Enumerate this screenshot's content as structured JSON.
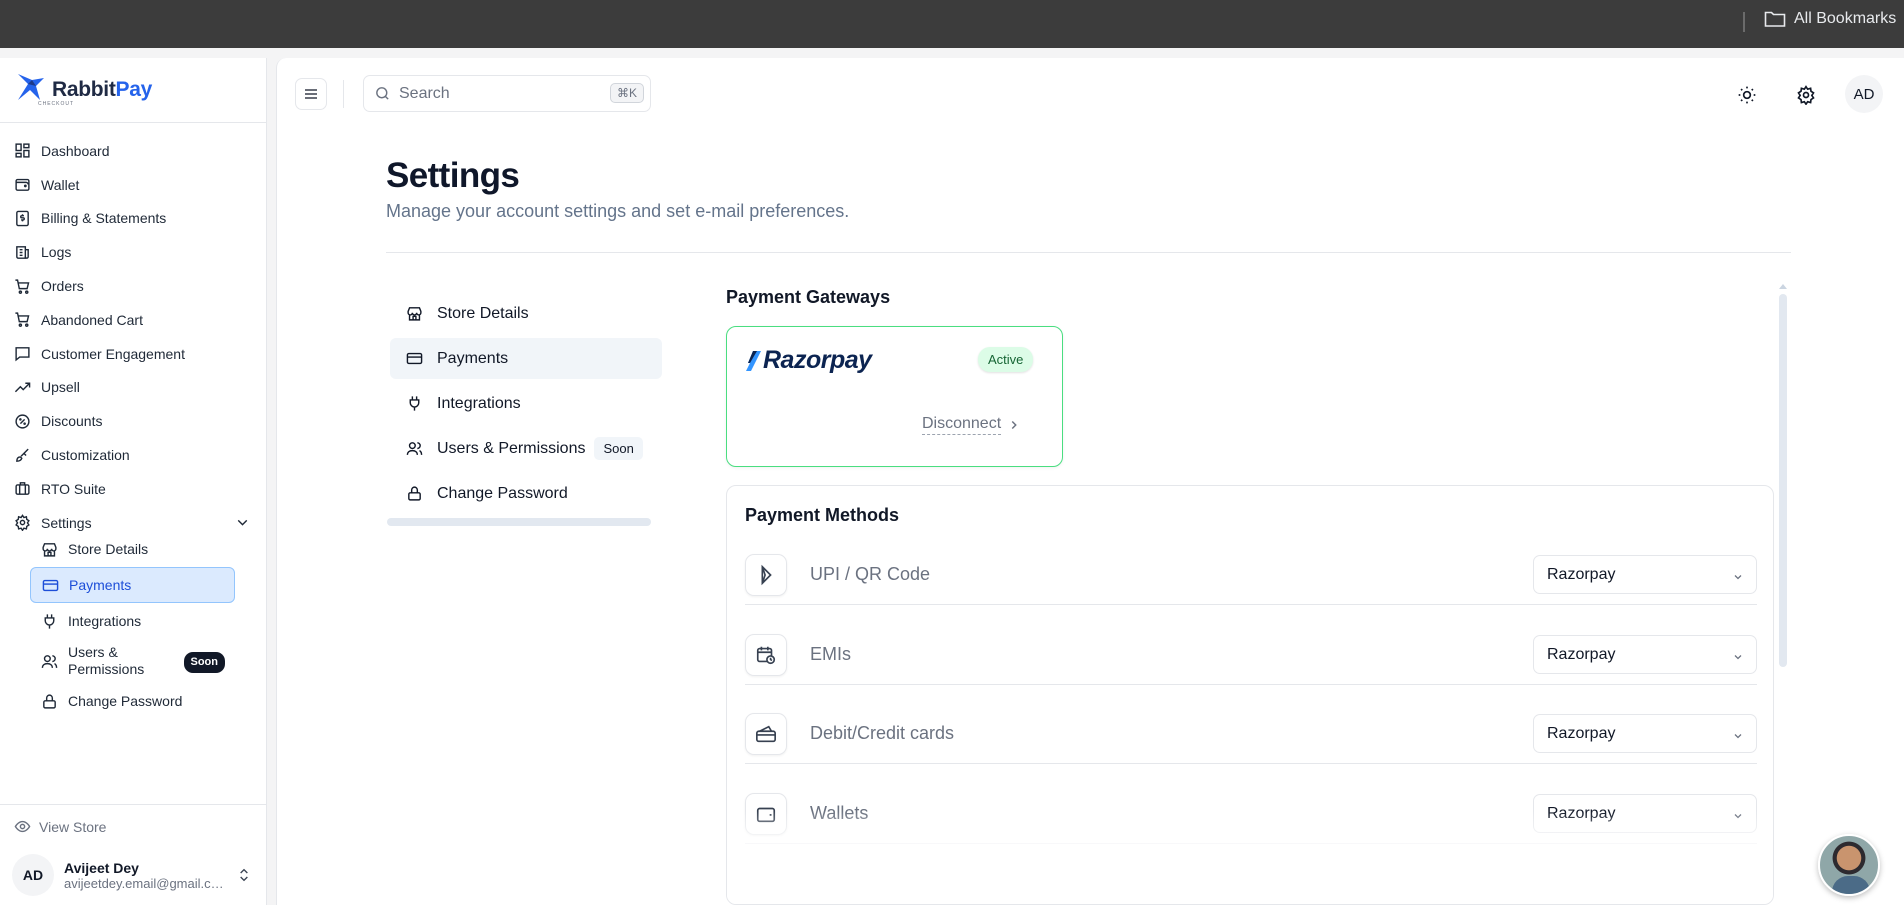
{
  "browser": {
    "bookmarks_label": "All Bookmarks"
  },
  "brand": {
    "name_part1": "Rabbit",
    "name_part2": "Pay",
    "tagline": "CHECKOUT",
    "color": "#2563eb"
  },
  "sidebar": {
    "items": [
      {
        "label": "Dashboard",
        "icon": "dashboard-icon"
      },
      {
        "label": "Wallet",
        "icon": "wallet-icon"
      },
      {
        "label": "Billing & Statements",
        "icon": "billing-icon"
      },
      {
        "label": "Logs",
        "icon": "logs-icon"
      },
      {
        "label": "Orders",
        "icon": "cart-icon"
      },
      {
        "label": "Abandoned Cart",
        "icon": "cart-icon"
      },
      {
        "label": "Customer Engagement",
        "icon": "message-icon"
      },
      {
        "label": "Upsell",
        "icon": "trending-up-icon"
      },
      {
        "label": "Discounts",
        "icon": "discount-icon"
      },
      {
        "label": "Customization",
        "icon": "paintbrush-icon"
      },
      {
        "label": "RTO Suite",
        "icon": "luggage-icon"
      },
      {
        "label": "Settings",
        "icon": "gear-icon"
      }
    ],
    "sub_items": [
      {
        "label": "Store Details",
        "icon": "store-icon"
      },
      {
        "label": "Payments",
        "icon": "card-icon",
        "active": true
      },
      {
        "label": "Integrations",
        "icon": "plug-icon"
      },
      {
        "label": "Users & Permissions",
        "icon": "users-icon",
        "badge": "Soon"
      },
      {
        "label": "Change Password",
        "icon": "lock-icon"
      }
    ],
    "view_store": "View Store",
    "user": {
      "initials": "AD",
      "name": "Avijeet Dey",
      "email": "avijeetdey.email@gmail.com"
    }
  },
  "header": {
    "search_placeholder": "Search",
    "shortcut": "⌘K",
    "avatar_initials": "AD"
  },
  "page": {
    "title": "Settings",
    "subtitle": "Manage your account settings and set e-mail preferences."
  },
  "settings_nav": [
    {
      "label": "Store Details",
      "icon": "store-icon"
    },
    {
      "label": "Payments",
      "icon": "card-icon",
      "active": true
    },
    {
      "label": "Integrations",
      "icon": "plug-icon"
    },
    {
      "label": "Users & Permissions",
      "icon": "users-icon",
      "badge": "Soon"
    },
    {
      "label": "Change Password",
      "icon": "lock-icon"
    }
  ],
  "gateways": {
    "title": "Payment Gateways",
    "razorpay": {
      "name": "Razorpay",
      "status": "Active",
      "action": "Disconnect",
      "status_color": "#dcfce7"
    }
  },
  "methods": {
    "title": "Payment Methods",
    "rows": [
      {
        "label": "UPI / QR Code",
        "provider": "Razorpay",
        "icon": "upi-icon"
      },
      {
        "label": "EMIs",
        "provider": "Razorpay",
        "icon": "calendar-clock-icon"
      },
      {
        "label": "Debit/Credit cards",
        "provider": "Razorpay",
        "icon": "cards-icon"
      },
      {
        "label": "Wallets",
        "provider": "Razorpay",
        "icon": "wallet-icon"
      }
    ]
  }
}
